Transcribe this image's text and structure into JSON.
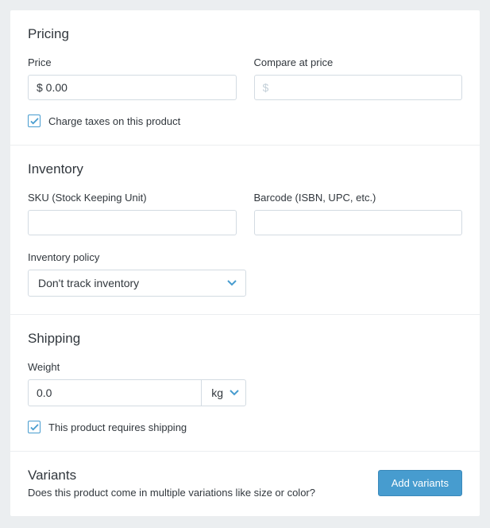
{
  "pricing": {
    "title": "Pricing",
    "price_label": "Price",
    "price_value": "$ 0.00",
    "compare_label": "Compare at price",
    "compare_placeholder": "$",
    "tax_label": "Charge taxes on this product"
  },
  "inventory": {
    "title": "Inventory",
    "sku_label": "SKU (Stock Keeping Unit)",
    "barcode_label": "Barcode (ISBN, UPC, etc.)",
    "policy_label": "Inventory policy",
    "policy_value": "Don't track inventory"
  },
  "shipping": {
    "title": "Shipping",
    "weight_label": "Weight",
    "weight_value": "0.0",
    "weight_unit": "kg",
    "requires_label": "This product requires shipping"
  },
  "variants": {
    "title": "Variants",
    "description": "Does this product come in multiple variations like size or color?",
    "button": "Add variants"
  }
}
